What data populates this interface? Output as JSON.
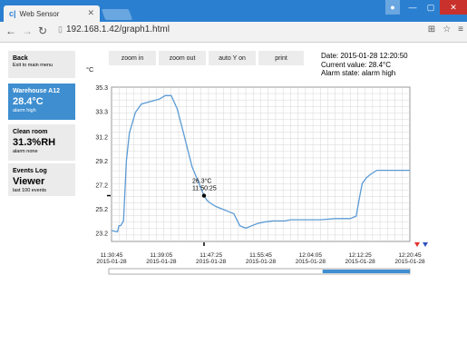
{
  "browser": {
    "tab_title": "Web Sensor",
    "tab_icon": "sensor-icon",
    "url": "192.168.1.42/graph1.html",
    "nav_icons": [
      "back-arrow-icon",
      "forward-arrow-icon",
      "reload-icon"
    ],
    "right_icons": [
      "translate-icon",
      "star-icon",
      "menu-icon"
    ]
  },
  "sidebar": {
    "back": {
      "title": "Back",
      "subtitle": "Exit to main menu"
    },
    "warehouse": {
      "title": "Warehouse A12",
      "value": "28.4°C",
      "status": "alarm high"
    },
    "cleanroom": {
      "title": "Clean room",
      "value": "31.3%RH",
      "status": "alarm none"
    },
    "events": {
      "title": "Events Log",
      "value": "Viewer",
      "status": "last 100 events"
    }
  },
  "toolbar": {
    "zoom_in": "zoom in",
    "zoom_out": "zoom out",
    "auto_y": "auto Y on",
    "print": "print"
  },
  "info": {
    "date": "Date: 2015-01-28 12:20:50",
    "current": "Current value: 28.4°C",
    "alarm": "Alarm state: alarm high"
  },
  "chart_data": {
    "type": "line",
    "ylabel": "°C",
    "y_ticks": [
      "35.3",
      "33.3",
      "31.2",
      "29.2",
      "27.2",
      "25.2",
      "23.2"
    ],
    "ylim": [
      22.5,
      35.3
    ],
    "x_ticks": [
      {
        "time": "11:30:45",
        "date": "2015-01-28"
      },
      {
        "time": "11:39:05",
        "date": "2015-01-28"
      },
      {
        "time": "11:47:25",
        "date": "2015-01-28"
      },
      {
        "time": "11:55:45",
        "date": "2015-01-28"
      },
      {
        "time": "12:04:05",
        "date": "2015-01-28"
      },
      {
        "time": "12:12:25",
        "date": "2015-01-28"
      },
      {
        "time": "12:20:45",
        "date": "2015-01-28"
      }
    ],
    "series_color": "#5b9bd5",
    "grid": true,
    "x": [
      0,
      0.02,
      0.025,
      0.03,
      0.04,
      0.05,
      0.06,
      0.08,
      0.1,
      0.13,
      0.16,
      0.18,
      0.2,
      0.22,
      0.24,
      0.27,
      0.31,
      0.32,
      0.33,
      0.35,
      0.37,
      0.39,
      0.41,
      0.43,
      0.45,
      0.47,
      0.49,
      0.51,
      0.54,
      0.58,
      0.6,
      0.65,
      0.7,
      0.75,
      0.8,
      0.82,
      0.83,
      0.84,
      0.855,
      0.87,
      0.89,
      0.91,
      1.0
    ],
    "values": [
      23.4,
      23.3,
      23.8,
      23.8,
      24.2,
      29.2,
      31.5,
      33.2,
      33.9,
      34.1,
      34.3,
      34.6,
      34.6,
      33.5,
      31.6,
      28.7,
      26.3,
      25.9,
      25.7,
      25.4,
      25.2,
      25.0,
      24.8,
      23.8,
      23.6,
      23.8,
      24.0,
      24.1,
      24.2,
      24.2,
      24.3,
      24.3,
      24.3,
      24.4,
      24.4,
      24.6,
      26.0,
      27.3,
      27.8,
      28.1,
      28.4,
      28.4,
      28.4
    ],
    "annotation": {
      "label": "26.3°C",
      "time": "11:50:25",
      "x": 0.31,
      "value": 26.3
    },
    "alarm_marker_colors": [
      "#e03030",
      "#3050c0"
    ],
    "scroll_position": 0.71
  }
}
